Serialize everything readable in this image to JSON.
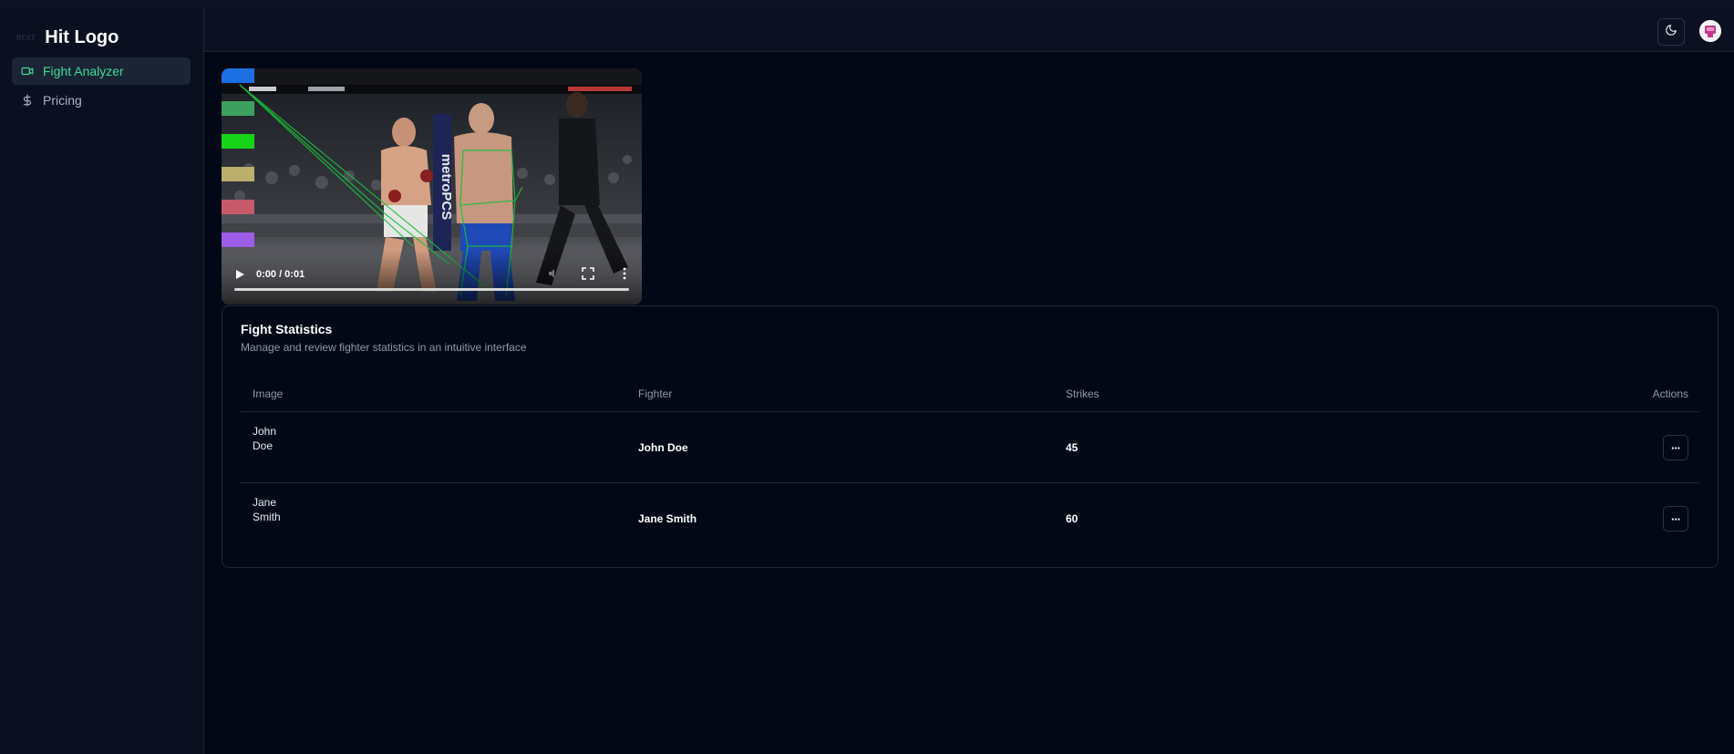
{
  "app": {
    "brand_mark": "NEXT",
    "brand_name": "Hit Logo"
  },
  "sidebar": {
    "items": [
      {
        "label": "Fight Analyzer",
        "icon": "video-icon",
        "active": true
      },
      {
        "label": "Pricing",
        "icon": "dollar-icon",
        "active": false
      }
    ]
  },
  "header": {
    "theme_icon": "moon-icon",
    "avatar_icon": "user-avatar"
  },
  "video": {
    "time": "0:00 / 0:01",
    "progress": 0
  },
  "stats": {
    "title": "Fight Statistics",
    "description": "Manage and review fighter statistics in an intuitive interface",
    "columns": [
      "Image",
      "Fighter",
      "Strikes",
      "Actions"
    ],
    "rows": [
      {
        "image_alt_1": "John",
        "image_alt_2": "Doe",
        "fighter": "John Doe",
        "strikes": "45",
        "action": "···"
      },
      {
        "image_alt_1": "Jane",
        "image_alt_2": "Smith",
        "fighter": "Jane Smith",
        "strikes": "60",
        "action": "···"
      }
    ]
  },
  "colors": {
    "accent": "#3ddc97",
    "background": "#030816",
    "sidebar": "#0a1020"
  }
}
